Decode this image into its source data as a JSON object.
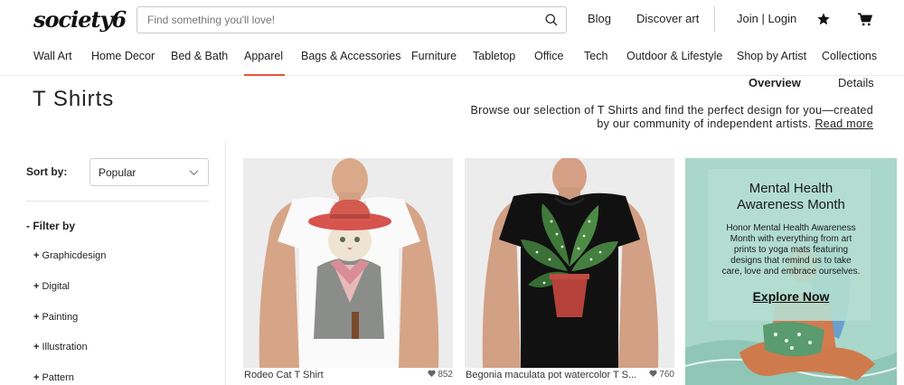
{
  "header": {
    "logo": "society6",
    "search_placeholder": "Find something you'll love!",
    "links": {
      "blog": "Blog",
      "discover": "Discover art",
      "login": "Join | Login"
    }
  },
  "nav": {
    "items": [
      "Wall Art",
      "Home Decor",
      "Bed & Bath",
      "Apparel",
      "Bags & Accessories",
      "Furniture",
      "Tabletop",
      "Office",
      "Tech",
      "Outdoor & Lifestyle",
      "Shop by Artist",
      "Collections"
    ],
    "active": "Apparel"
  },
  "page": {
    "title": "T Shirts",
    "tabs": {
      "overview": "Overview",
      "details": "Details"
    },
    "description_line1": "Browse our selection of T Shirts and find the perfect design for you—created",
    "description_line2": "by our community of independent artists.",
    "read_more": "Read more"
  },
  "sidebar": {
    "sort_label": "Sort by:",
    "sort_value": "Popular",
    "filter_heading": "- Filter by",
    "filters": [
      "Graphicdesign",
      "Digital",
      "Painting",
      "Illustration",
      "Pattern"
    ]
  },
  "products": [
    {
      "title": "Rodeo Cat T Shirt",
      "likes": "852"
    },
    {
      "title": "Begonia maculata pot watercolor T S...",
      "likes": "760"
    }
  ],
  "promo": {
    "title_line1": "Mental Health",
    "title_line2": "Awareness Month",
    "text": "Honor Mental Health Awareness Month with everything from art prints to yoga mats featuring designs that remind us to take care, love and embrace ourselves.",
    "cta": "Explore Now"
  },
  "colors": {
    "accent_underline": "#e8543b",
    "highlight": "#ffe600",
    "promo_bg": "#a9d7c9"
  }
}
